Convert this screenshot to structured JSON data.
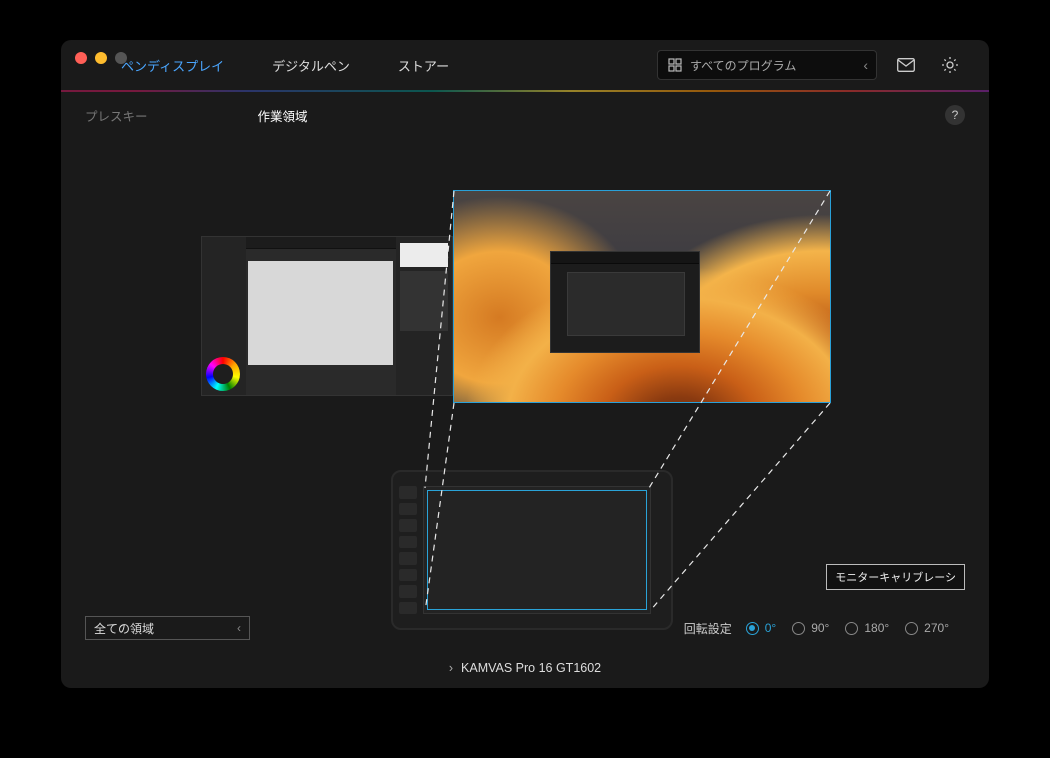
{
  "topTabs": {
    "pen_display": "ペンディスプレイ",
    "digital_pen": "デジタルペン",
    "store": "ストアー"
  },
  "programSelect": {
    "label": "すべてのプログラム"
  },
  "subTabs": {
    "press_key": "プレスキー",
    "work_area": "作業領域"
  },
  "help": "?",
  "monitorCalibration": "モニターキャリブレーシ",
  "areaSelect": {
    "label": "全ての領域"
  },
  "rotation": {
    "label": "回転設定",
    "options": {
      "r0": "0°",
      "r90": "90°",
      "r180": "180°",
      "r270": "270°"
    },
    "selected": "r0"
  },
  "device": "KAMVAS Pro 16 GT1602"
}
